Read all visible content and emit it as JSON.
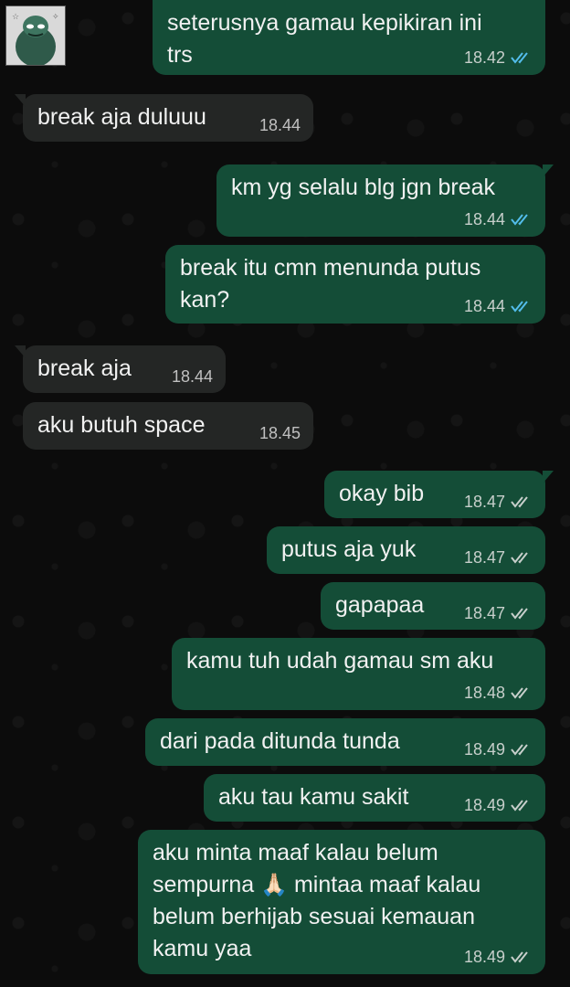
{
  "theme": {
    "outgoing_bubble": "#144d37",
    "incoming_bubble": "#242625",
    "read_ticks": "#53bdeb",
    "delivered_ticks": "#c7cfcb"
  },
  "messages": [
    {
      "dir": "out",
      "text": "seterusnya gamau kepikiran ini\ntrs",
      "time": "18.42",
      "status": "read"
    },
    {
      "dir": "in",
      "text": "break aja duluuu",
      "time": "18.44"
    },
    {
      "dir": "out",
      "text": "km yg selalu blg jgn break",
      "time": "18.44",
      "status": "read"
    },
    {
      "dir": "out",
      "text": "break itu cmn menunda putus\nkan?",
      "time": "18.44",
      "status": "read"
    },
    {
      "dir": "in",
      "text": "break aja",
      "time": "18.44"
    },
    {
      "dir": "in",
      "text": "aku butuh space",
      "time": "18.45"
    },
    {
      "dir": "out",
      "text": "okay bib",
      "time": "18.47",
      "status": "delivered"
    },
    {
      "dir": "out",
      "text": "putus aja yuk",
      "time": "18.47",
      "status": "delivered"
    },
    {
      "dir": "out",
      "text": "gapapaa",
      "time": "18.47",
      "status": "delivered"
    },
    {
      "dir": "out",
      "text": "kamu tuh udah gamau sm aku",
      "time": "18.48",
      "status": "delivered"
    },
    {
      "dir": "out",
      "text": "dari pada ditunda tunda",
      "time": "18.49",
      "status": "delivered"
    },
    {
      "dir": "out",
      "text": "aku tau kamu sakit",
      "time": "18.49",
      "status": "delivered"
    },
    {
      "dir": "out",
      "text_parts": [
        "aku minta maaf kalau belum\nsempurna ",
        "🙏🏻",
        " mintaa maaf kalau\nbelum berhijab sesuai kemauan\nkamu yaa"
      ],
      "time": "18.49",
      "status": "delivered"
    }
  ]
}
